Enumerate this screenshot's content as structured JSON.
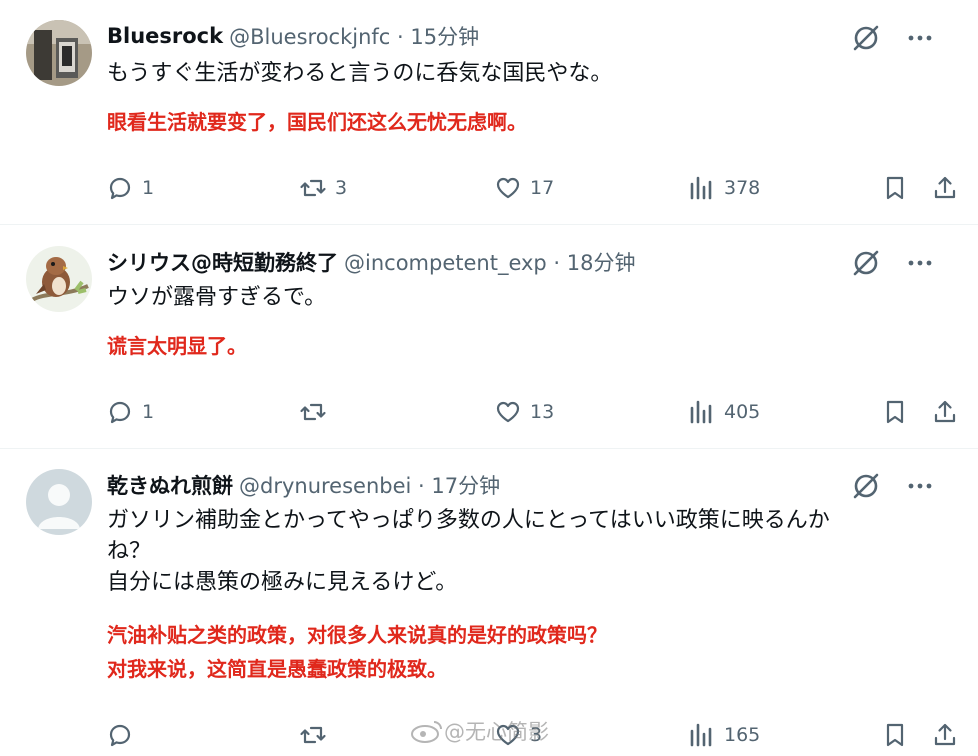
{
  "tweets": [
    {
      "name": "Bluesrock",
      "handle_time": "@Bluesrockjnfc · 15分钟",
      "text": [
        "もうすぐ生活が変わると言うのに呑気な国民やな。"
      ],
      "translation": [
        "眼看生活就要变了，国民们还这么无忧无虑啊。"
      ],
      "replies": "1",
      "retweets": "3",
      "likes": "17",
      "views": "378"
    },
    {
      "name": "シリウス@時短勤務終了",
      "handle_time": "@incompetent_exp · 18分钟",
      "text": [
        "ウソが露骨すぎるで。"
      ],
      "translation": [
        "谎言太明显了。"
      ],
      "replies": "1",
      "retweets": "",
      "likes": "13",
      "views": "405"
    },
    {
      "name": "乾きぬれ煎餅",
      "handle_time": "@drynuresenbei · 17分钟",
      "text": [
        "ガソリン補助金とかってやっぱり多数の人にとってはいい政策に映るんか",
        "ね？",
        "自分には愚策の極みに見えるけど。"
      ],
      "translation": [
        "汽油补贴之类的政策，对很多人来说真的是好的政策吗？",
        "对我来说，这简直是愚蠢政策的极致。"
      ],
      "replies": "",
      "retweets": "",
      "likes": "3",
      "views": "165"
    }
  ],
  "watermark": "@无心简影",
  "colors": {
    "translation": "#e0281c",
    "secondary": "#536471",
    "divider": "#eff3f4"
  },
  "icons": [
    "reply-icon",
    "retweet-icon",
    "like-icon",
    "views-icon",
    "bookmark-icon",
    "share-icon",
    "grok-icon",
    "more-icon"
  ]
}
